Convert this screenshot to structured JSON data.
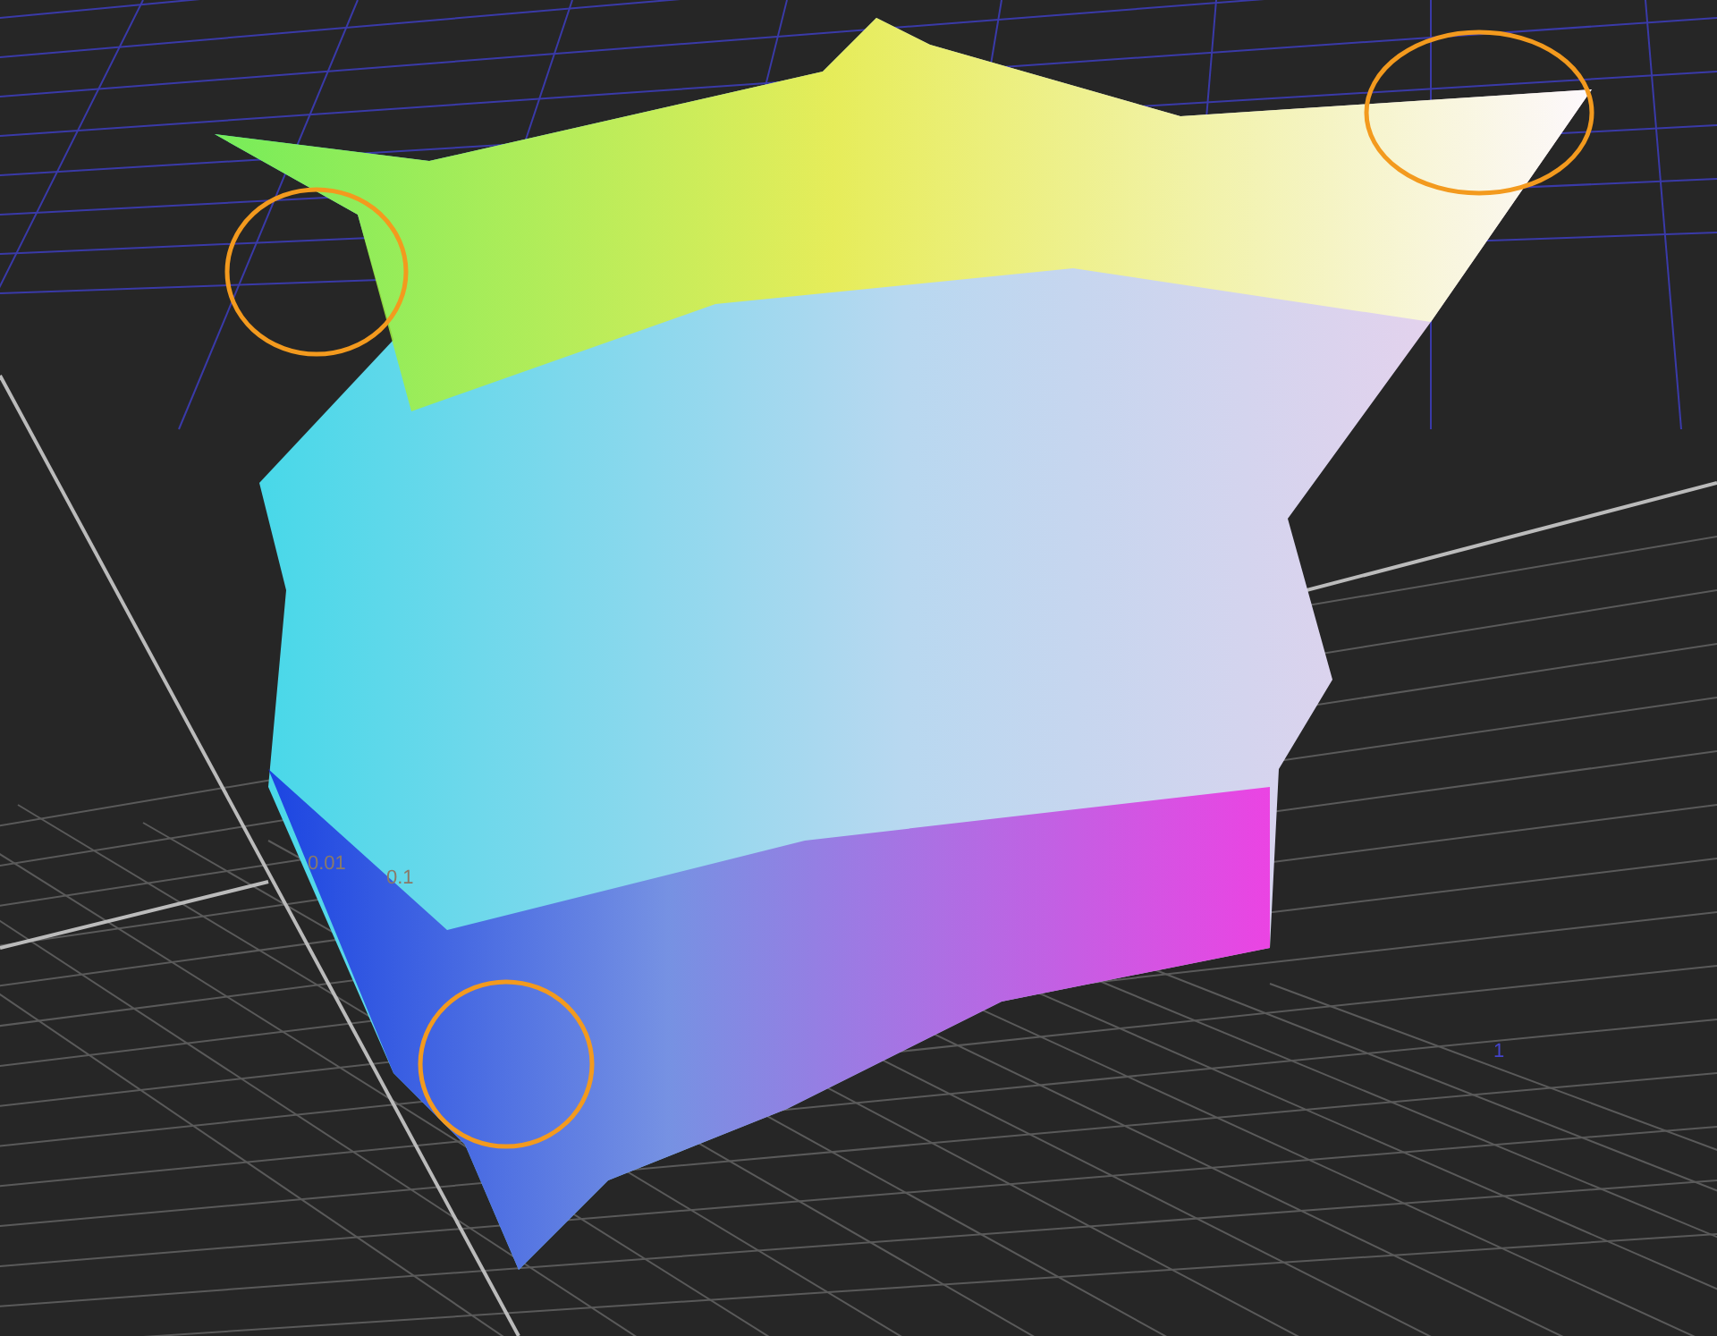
{
  "viewport": {
    "axis_labels": [
      {
        "text": "0.01",
        "color": "#8a7a68"
      },
      {
        "text": "0.1",
        "color": "#8a7a68"
      },
      {
        "text": "1",
        "color": "#4444cc"
      }
    ]
  }
}
